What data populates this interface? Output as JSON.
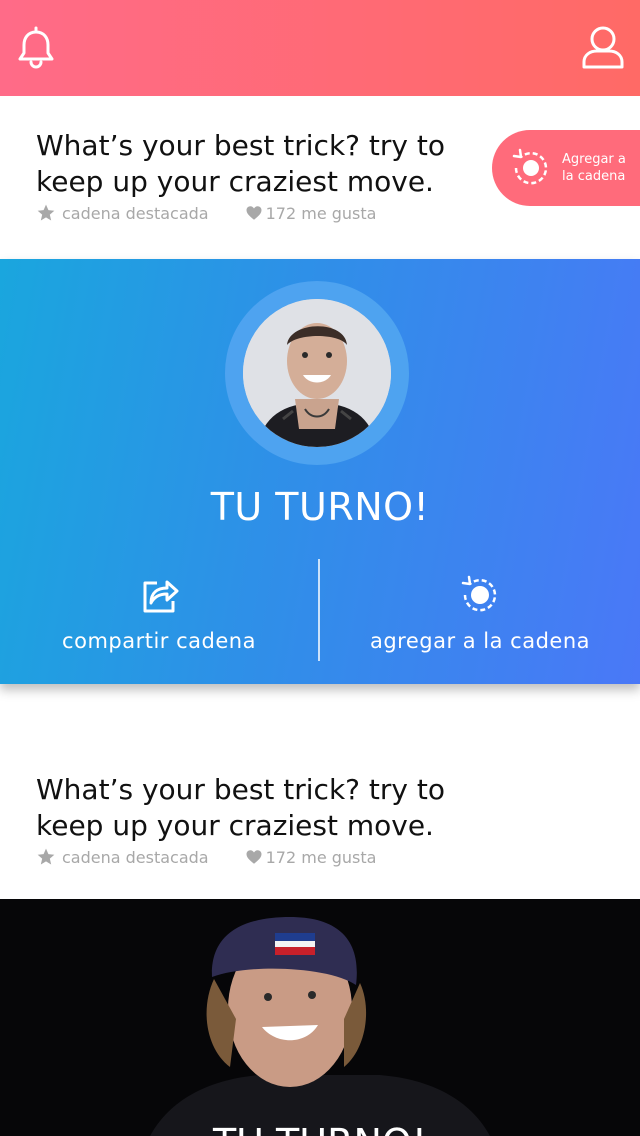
{
  "header": {
    "notifications_icon": "bell-icon",
    "profile_icon": "user-icon"
  },
  "posts": [
    {
      "title": "What’s your best trick? try to keep up your craziest move.",
      "featured_label": "cadena destacada",
      "likes_label": "172 me gusta",
      "add_button": {
        "label": "Agregar a la cadena",
        "icon": "chain-rotate-icon"
      }
    },
    {
      "title": "What’s your best trick? try to keep up your craziest move.",
      "featured_label": "cadena destacada",
      "likes_label": "172 me gusta"
    }
  ],
  "turn_card": {
    "label": "TU TURNO!",
    "share_label": "compartir  cadena",
    "add_label": "agregar  a la cadena"
  },
  "photo_card": {
    "label": "TU TURNO!"
  },
  "colors": {
    "topbar_start": "#ff6b88",
    "topbar_end": "#ff6a66",
    "accent_pink": "#ff6b7b",
    "blue_start": "#1aa6de",
    "blue_end": "#4a78f7",
    "meta_gray": "#a8a8a8"
  }
}
